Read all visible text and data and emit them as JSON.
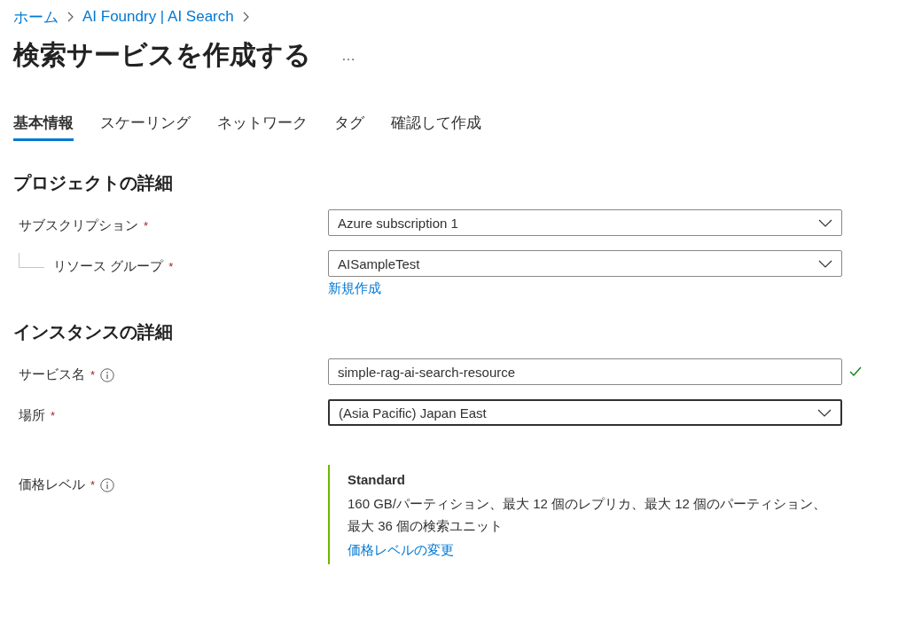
{
  "breadcrumb": [
    "ホーム",
    "AI Foundry | AI Search"
  ],
  "title": "検索サービスを作成する",
  "more": "…",
  "tabs": [
    {
      "label": "基本情報",
      "selected": true
    },
    {
      "label": "スケーリング",
      "selected": false
    },
    {
      "label": "ネットワーク",
      "selected": false
    },
    {
      "label": "タグ",
      "selected": false
    },
    {
      "label": "確認して作成",
      "selected": false
    }
  ],
  "sections": [
    {
      "heading": "プロジェクトの詳細",
      "fields": [
        {
          "kind": "dropdown",
          "label": "サブスクリプション",
          "required_mark": "*",
          "info": false,
          "nested": false,
          "value": "Azure subscription 1",
          "focused": false,
          "valid": false
        },
        {
          "kind": "dropdown",
          "label": "リソース グループ",
          "required_mark": "*",
          "info": false,
          "nested": true,
          "value": "AISampleTest",
          "focused": false,
          "valid": false,
          "link": "新規作成"
        }
      ]
    },
    {
      "heading": "インスタンスの詳細",
      "fields": [
        {
          "kind": "text",
          "label": "サービス名",
          "required_mark": "*",
          "info": true,
          "nested": false,
          "value": "simple-rag-ai-search-resource",
          "focused": false,
          "valid": true
        },
        {
          "kind": "dropdown",
          "label": "場所",
          "required_mark": "*",
          "info": false,
          "nested": false,
          "value": "(Asia Pacific) Japan East",
          "focused": true,
          "valid": false
        },
        {
          "kind": "tier",
          "label": "価格レベル",
          "required_mark": "*",
          "info": true,
          "nested": false,
          "tier_name": "Standard",
          "description": "160 GB/パーティション、最大 12 個のレプリカ、最大 12 個のパーティション、最大 36 個の検索ユニット",
          "link": "価格レベルの変更"
        }
      ]
    }
  ]
}
